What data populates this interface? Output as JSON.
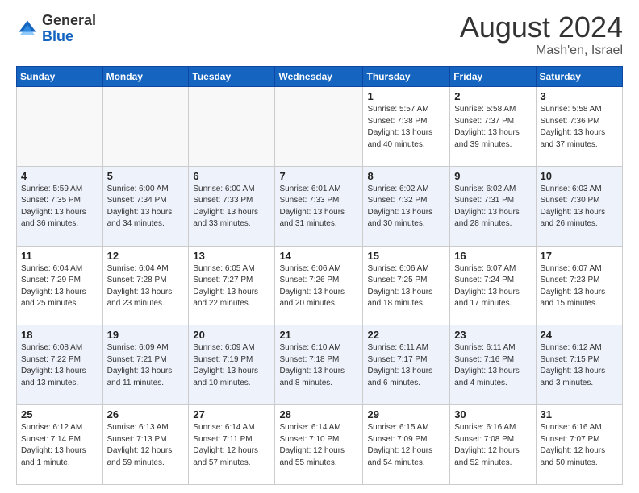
{
  "header": {
    "logo_general": "General",
    "logo_blue": "Blue",
    "month_year": "August 2024",
    "location": "Mash'en, Israel"
  },
  "days_of_week": [
    "Sunday",
    "Monday",
    "Tuesday",
    "Wednesday",
    "Thursday",
    "Friday",
    "Saturday"
  ],
  "weeks": [
    [
      {
        "day": "",
        "info": ""
      },
      {
        "day": "",
        "info": ""
      },
      {
        "day": "",
        "info": ""
      },
      {
        "day": "",
        "info": ""
      },
      {
        "day": "1",
        "info": "Sunrise: 5:57 AM\nSunset: 7:38 PM\nDaylight: 13 hours\nand 40 minutes."
      },
      {
        "day": "2",
        "info": "Sunrise: 5:58 AM\nSunset: 7:37 PM\nDaylight: 13 hours\nand 39 minutes."
      },
      {
        "day": "3",
        "info": "Sunrise: 5:58 AM\nSunset: 7:36 PM\nDaylight: 13 hours\nand 37 minutes."
      }
    ],
    [
      {
        "day": "4",
        "info": "Sunrise: 5:59 AM\nSunset: 7:35 PM\nDaylight: 13 hours\nand 36 minutes."
      },
      {
        "day": "5",
        "info": "Sunrise: 6:00 AM\nSunset: 7:34 PM\nDaylight: 13 hours\nand 34 minutes."
      },
      {
        "day": "6",
        "info": "Sunrise: 6:00 AM\nSunset: 7:33 PM\nDaylight: 13 hours\nand 33 minutes."
      },
      {
        "day": "7",
        "info": "Sunrise: 6:01 AM\nSunset: 7:33 PM\nDaylight: 13 hours\nand 31 minutes."
      },
      {
        "day": "8",
        "info": "Sunrise: 6:02 AM\nSunset: 7:32 PM\nDaylight: 13 hours\nand 30 minutes."
      },
      {
        "day": "9",
        "info": "Sunrise: 6:02 AM\nSunset: 7:31 PM\nDaylight: 13 hours\nand 28 minutes."
      },
      {
        "day": "10",
        "info": "Sunrise: 6:03 AM\nSunset: 7:30 PM\nDaylight: 13 hours\nand 26 minutes."
      }
    ],
    [
      {
        "day": "11",
        "info": "Sunrise: 6:04 AM\nSunset: 7:29 PM\nDaylight: 13 hours\nand 25 minutes."
      },
      {
        "day": "12",
        "info": "Sunrise: 6:04 AM\nSunset: 7:28 PM\nDaylight: 13 hours\nand 23 minutes."
      },
      {
        "day": "13",
        "info": "Sunrise: 6:05 AM\nSunset: 7:27 PM\nDaylight: 13 hours\nand 22 minutes."
      },
      {
        "day": "14",
        "info": "Sunrise: 6:06 AM\nSunset: 7:26 PM\nDaylight: 13 hours\nand 20 minutes."
      },
      {
        "day": "15",
        "info": "Sunrise: 6:06 AM\nSunset: 7:25 PM\nDaylight: 13 hours\nand 18 minutes."
      },
      {
        "day": "16",
        "info": "Sunrise: 6:07 AM\nSunset: 7:24 PM\nDaylight: 13 hours\nand 17 minutes."
      },
      {
        "day": "17",
        "info": "Sunrise: 6:07 AM\nSunset: 7:23 PM\nDaylight: 13 hours\nand 15 minutes."
      }
    ],
    [
      {
        "day": "18",
        "info": "Sunrise: 6:08 AM\nSunset: 7:22 PM\nDaylight: 13 hours\nand 13 minutes."
      },
      {
        "day": "19",
        "info": "Sunrise: 6:09 AM\nSunset: 7:21 PM\nDaylight: 13 hours\nand 11 minutes."
      },
      {
        "day": "20",
        "info": "Sunrise: 6:09 AM\nSunset: 7:19 PM\nDaylight: 13 hours\nand 10 minutes."
      },
      {
        "day": "21",
        "info": "Sunrise: 6:10 AM\nSunset: 7:18 PM\nDaylight: 13 hours\nand 8 minutes."
      },
      {
        "day": "22",
        "info": "Sunrise: 6:11 AM\nSunset: 7:17 PM\nDaylight: 13 hours\nand 6 minutes."
      },
      {
        "day": "23",
        "info": "Sunrise: 6:11 AM\nSunset: 7:16 PM\nDaylight: 13 hours\nand 4 minutes."
      },
      {
        "day": "24",
        "info": "Sunrise: 6:12 AM\nSunset: 7:15 PM\nDaylight: 13 hours\nand 3 minutes."
      }
    ],
    [
      {
        "day": "25",
        "info": "Sunrise: 6:12 AM\nSunset: 7:14 PM\nDaylight: 13 hours\nand 1 minute."
      },
      {
        "day": "26",
        "info": "Sunrise: 6:13 AM\nSunset: 7:13 PM\nDaylight: 12 hours\nand 59 minutes."
      },
      {
        "day": "27",
        "info": "Sunrise: 6:14 AM\nSunset: 7:11 PM\nDaylight: 12 hours\nand 57 minutes."
      },
      {
        "day": "28",
        "info": "Sunrise: 6:14 AM\nSunset: 7:10 PM\nDaylight: 12 hours\nand 55 minutes."
      },
      {
        "day": "29",
        "info": "Sunrise: 6:15 AM\nSunset: 7:09 PM\nDaylight: 12 hours\nand 54 minutes."
      },
      {
        "day": "30",
        "info": "Sunrise: 6:16 AM\nSunset: 7:08 PM\nDaylight: 12 hours\nand 52 minutes."
      },
      {
        "day": "31",
        "info": "Sunrise: 6:16 AM\nSunset: 7:07 PM\nDaylight: 12 hours\nand 50 minutes."
      }
    ]
  ]
}
